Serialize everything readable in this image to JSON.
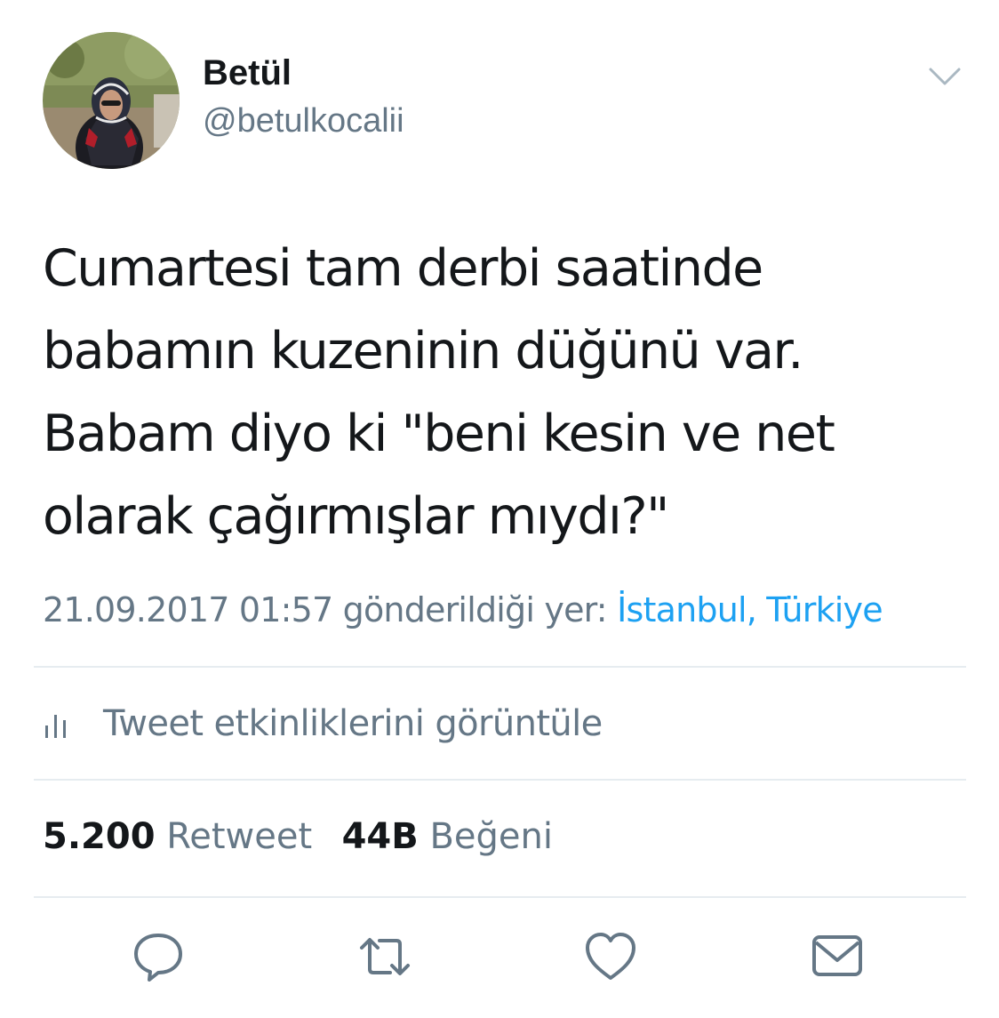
{
  "user": {
    "display_name": "Betül",
    "username": "@betulkocalii"
  },
  "tweet": {
    "lines": [
      "Cumartesi tam derbi saatinde",
      "babamın kuzeninin düğünü var.",
      "Babam diyo ki \"beni kesin ve net",
      "olarak çağırmışlar mıydı?\""
    ],
    "timestamp": "21.09.2017 01:57",
    "sent_from_label": "gönderildiği yer:",
    "location": "İstanbul, Türkiye"
  },
  "activity": {
    "label": "Tweet etkinliklerini görüntüle",
    "icon": "analytics-bars-icon"
  },
  "stats": {
    "retweet_count": "5.200",
    "retweet_label": "Retweet",
    "like_count": "44B",
    "like_label": "Beğeni"
  },
  "actions": [
    "reply-icon",
    "retweet-icon",
    "like-icon",
    "dm-icon"
  ],
  "colors": {
    "text": "#14171a",
    "secondary": "#657786",
    "link": "#1da1f2",
    "divider": "#e6ecf0"
  }
}
